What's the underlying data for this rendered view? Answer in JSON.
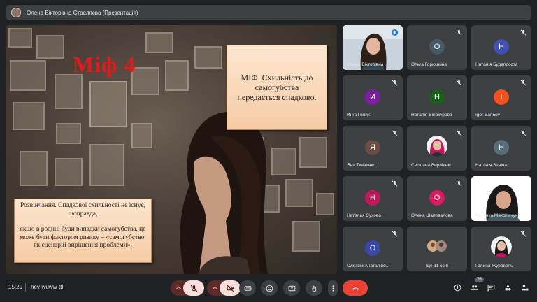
{
  "window": {
    "title": "Олена Вікторівна Стреляєва (Презентація)"
  },
  "slide": {
    "myth_title": "Міф 4",
    "myth_text": "МІФ. Схильність до самогубства передається спадково.",
    "debunk_p1": "Розвінчання. Спадкової схильності не існує, щоправда,",
    "debunk_p2": "якщо в родині були випадки самогубства, це може бути фактором ризику – «самогубство, як сценарій вирішення проблеми»."
  },
  "participants": [
    {
      "name": "Олена Вікторівна ...",
      "initial": "",
      "color": "",
      "video": true,
      "speaking": true
    },
    {
      "name": "Ольга Горюшина",
      "initial": "О",
      "color": "#455a64",
      "muted": true
    },
    {
      "name": "Наталія Будапроста",
      "initial": "Н",
      "color": "#3f51b5",
      "muted": true
    },
    {
      "name": "Инга Голик",
      "initial": "И",
      "color": "#7b1fa2",
      "muted": true
    },
    {
      "name": "Наталія Вінокурова",
      "initial": "Н",
      "color": "#1b5e20",
      "muted": true
    },
    {
      "name": "Igor Barinov",
      "initial": "I",
      "color": "#f4511e",
      "muted": true
    },
    {
      "name": "Яна Ткаченко",
      "initial": "Я",
      "color": "#6d4c41",
      "muted": true
    },
    {
      "name": "Світлана Верлієнко",
      "initial": "",
      "color": "#ffffff",
      "muted": true,
      "photo": true
    },
    {
      "name": "Наталія Зеніна",
      "initial": "Н",
      "color": "#546e7a",
      "muted": true
    },
    {
      "name": "Наталья Сухова",
      "initial": "Н",
      "color": "#c2185b",
      "muted": true
    },
    {
      "name": "Олена Шаповалова",
      "initial": "О",
      "color": "#d81b60",
      "muted": true
    },
    {
      "name": "Наталка Максимчук",
      "initial": "",
      "color": "",
      "video": true
    },
    {
      "name": "Олексій Анатолійо...",
      "initial": "О",
      "color": "#3949ab",
      "muted": true
    },
    {
      "name": "Ще 11 осіб",
      "initial": "",
      "color": "",
      "group": true
    },
    {
      "name": "Галина Журавель",
      "initial": "",
      "color": "#ffffff",
      "muted": true,
      "photo": true
    }
  ],
  "bottom": {
    "time": "15:29",
    "meeting_code": "hev-wuww-ttl",
    "people_count": "26"
  }
}
